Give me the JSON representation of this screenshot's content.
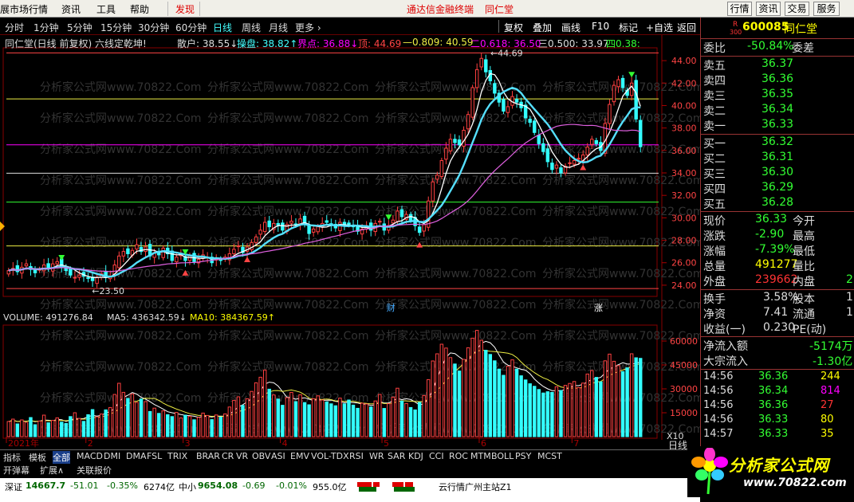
{
  "menu": {
    "items": [
      "展市场行情",
      "资讯",
      "工具",
      "帮助"
    ],
    "discover": "发现",
    "center_title": "通达信金融终端",
    "stock_title": "同仁堂",
    "right_buttons": [
      "行情",
      "资讯",
      "交易",
      "服务"
    ]
  },
  "toolbar": {
    "periods": [
      "分时",
      "1分钟",
      "5分钟",
      "15分钟",
      "30分钟",
      "60分钟",
      "日线",
      "周线",
      "月线",
      "更多 ›"
    ],
    "active_period": "日线",
    "tools": [
      "复权",
      "叠加",
      "画线",
      "F10",
      "标记",
      "+自选",
      "返回"
    ]
  },
  "info": {
    "title": "同仁堂(日线 前复权) 六线定乾坤!",
    "sanhu": "散户: 38.55↓",
    "caopan": "操盘: 38.82↑",
    "jiedian": "界点: 36.88↓",
    "ding": "顶: 44.69",
    "l0809": "—0.809: 40.59",
    "l0618": "二0.618: 36.50",
    "l0500": "三0.500: 33.97",
    "l038": "四0.38:"
  },
  "chart": {
    "price_ticks": [
      "44.00",
      "42.00",
      "40.00",
      "38.00",
      "36.00",
      "34.00",
      "32.00",
      "30.00",
      "28.00",
      "26.00",
      "24.00"
    ],
    "vol_ticks": [
      "60000",
      "45000",
      "30000",
      "15000"
    ],
    "vol_unit": "X10",
    "high_label": "44.69",
    "low_label": "23.50",
    "x_labels": [
      "2021年",
      "2",
      "3",
      "4",
      "5",
      "6",
      "7"
    ],
    "event_cai": "财",
    "event_zhang": "涨",
    "watermark": "分析家公式网www.70822.Com",
    "period_label": "日线",
    "colors": {
      "up": "#ff4040",
      "down": "#33ffff",
      "ma5": "#ffffff",
      "ma10": "#55e0ff",
      "ma_long": "#e060e0",
      "yellow": "#e8e840",
      "green": "#40e040"
    }
  },
  "chart_data": {
    "type": "candlestick",
    "title": "同仁堂(日线 前复权) 六线定乾坤!",
    "ylim": [
      23,
      45
    ],
    "high": 44.69,
    "low": 23.5,
    "levels": [
      {
        "name": "顶",
        "value": 44.69
      },
      {
        "name": "0.809",
        "value": 40.59
      },
      {
        "name": "0.618",
        "value": 36.5
      },
      {
        "name": "0.500",
        "value": 33.97
      },
      {
        "name": "0.38",
        "value": 31.4
      },
      {
        "name": "lower1",
        "value": 27.5
      },
      {
        "name": "lower2",
        "value": 23.7
      }
    ],
    "close": [
      25.3,
      25.5,
      25.2,
      25.6,
      25.9,
      25.4,
      25.1,
      25.4,
      25.8,
      25.5,
      25.9,
      26.1,
      25.7,
      25.3,
      24.9,
      24.7,
      24.9,
      24.8,
      24.6,
      24.4,
      24.7,
      25.0,
      24.7,
      24.8,
      25.8,
      26.6,
      27.0,
      26.8,
      27.1,
      27.6,
      27.0,
      27.4,
      26.6,
      26.9,
      26.7,
      27.3,
      26.8,
      26.2,
      26.5,
      26.8,
      26.2,
      26.6,
      26.1,
      26.3,
      26.7,
      26.5,
      26.0,
      26.4,
      26.2,
      26.5,
      26.8,
      27.2,
      27.5,
      26.9,
      27.4,
      27.8,
      28.3,
      28.9,
      29.6,
      29.2,
      29.5,
      29.3,
      28.9,
      29.4,
      29.7,
      29.4,
      29.9,
      29.5,
      28.6,
      29.0,
      29.2,
      29.5,
      29.6,
      29.3,
      29.1,
      29.6,
      29.3,
      29.4,
      29.2,
      28.8,
      29.0,
      29.3,
      28.9,
      29.5,
      29.7,
      28.9,
      29.3,
      29.8,
      30.6,
      30.1,
      30.3,
      29.8,
      29.3,
      28.7,
      29.4,
      31.5,
      33.2,
      33.8,
      35.1,
      36.2,
      37.0,
      36.7,
      36.5,
      37.8,
      39.2,
      41.6,
      43.2,
      44.2,
      43.0,
      42.2,
      41.1,
      40.3,
      39.5,
      39.9,
      40.8,
      40.3,
      39.8,
      38.9,
      38.5,
      37.6,
      36.6,
      35.9,
      35.0,
      34.3,
      34.7,
      34.0,
      34.6,
      34.9,
      35.1,
      35.3,
      35.6,
      36.3,
      37.0,
      36.6,
      36.0,
      38.4,
      40.1,
      41.8,
      42.3,
      41.6,
      40.9,
      42.0,
      38.8,
      36.33
    ],
    "volume": [
      9500,
      11000,
      8000,
      10500,
      9000,
      12000,
      7500,
      9800,
      13500,
      8700,
      10200,
      11800,
      9100,
      8300,
      12600,
      15000,
      11400,
      9600,
      13800,
      17000,
      12500,
      14200,
      16800,
      18300,
      26500,
      33500,
      27800,
      24000,
      26800,
      21500,
      23600,
      22000,
      15800,
      17900,
      14600,
      16200,
      13800,
      12600,
      15200,
      11800,
      13500,
      12800,
      10600,
      12100,
      14800,
      13300,
      10700,
      13600,
      12200,
      14300,
      18600,
      22800,
      25000,
      19600,
      23800,
      28400,
      33800,
      37300,
      41800,
      29800,
      26200,
      23600,
      19700,
      24500,
      27800,
      22000,
      26300,
      21400,
      20000,
      23800,
      25600,
      23000,
      21800,
      20600,
      19400,
      24200,
      20600,
      23000,
      19800,
      17800,
      21000,
      20500,
      18600,
      22400,
      26500,
      17700,
      20700,
      24800,
      30400,
      22300,
      20800,
      18300,
      16800,
      21500,
      25800,
      35800,
      47500,
      52000,
      58000,
      55600,
      49600,
      45600,
      41200,
      48500,
      55800,
      61800,
      66700,
      60500,
      54200,
      51600,
      47600,
      42400,
      38500,
      44200,
      48200,
      42400,
      38200,
      35600,
      33200,
      31600,
      29600,
      27400,
      28200,
      27800,
      31300,
      29000,
      32200,
      33400,
      34600,
      30800,
      33600,
      39300,
      41500,
      37200,
      34400,
      47600,
      51800,
      47300,
      44600,
      40800,
      43200,
      52000,
      49500,
      49127
    ]
  },
  "vol_info": {
    "volume": "VOLUME: 491276.84",
    "ma5": "MA5: 436342.59↓",
    "ma10": "MA10: 384367.59↑"
  },
  "tabs": [
    "指标",
    "模板",
    "全部",
    "MACD",
    "DMI",
    "DMA",
    "FSL",
    "TRIX",
    "BRAR",
    "CR",
    "VR",
    "OBV",
    "ASI",
    "EMV",
    "VOL-TDX",
    "RSI",
    "WR",
    "SAR",
    "KDJ",
    "CCI",
    "ROC",
    "MTM",
    "BOLL",
    "PSY",
    "MCST"
  ],
  "tabs2": [
    "开弹幕",
    "扩展∧",
    "关联报价"
  ],
  "status": {
    "sz_label": "深证",
    "sz_val": "14667.7",
    "sz_chg": "-51.01",
    "sz_pct": "-0.35%",
    "sz_amt": "6274亿",
    "zx_label": "中小",
    "zx_val": "9654.08",
    "zx_chg": "-0.69",
    "zx_pct": "-0.01%",
    "zx_amt": "955.0亿",
    "server": "云行情广州主站Z1"
  },
  "quote": {
    "code": "600085",
    "name": "同仁堂",
    "r_label": "R",
    "r_num": "300",
    "webi_label": "委比",
    "webi_val": "-50.84%",
    "weicha_label": "委差",
    "sells": [
      {
        "l": "卖五",
        "p": "36.37"
      },
      {
        "l": "卖四",
        "p": "36.36"
      },
      {
        "l": "卖三",
        "p": "36.35"
      },
      {
        "l": "卖二",
        "p": "36.34"
      },
      {
        "l": "卖一",
        "p": "36.33"
      }
    ],
    "buys": [
      {
        "l": "买一",
        "p": "36.32"
      },
      {
        "l": "买二",
        "p": "36.31"
      },
      {
        "l": "买三",
        "p": "36.30"
      },
      {
        "l": "买四",
        "p": "36.29"
      },
      {
        "l": "买五",
        "p": "36.28"
      }
    ],
    "xianjia": {
      "l": "现价",
      "v": "36.33",
      "r": "今开"
    },
    "zhangdie": {
      "l": "涨跌",
      "v": "-2.90",
      "r": "最高"
    },
    "zhangfu": {
      "l": "涨幅",
      "v": "-7.39%",
      "r": "最低"
    },
    "zongliang": {
      "l": "总量",
      "v": "491277",
      "r": "量比"
    },
    "waipan": {
      "l": "外盘",
      "v": "239662",
      "r": "内盘",
      "rv": "2"
    },
    "huanshou": {
      "l": "换手",
      "v": "3.58%",
      "r": "股本",
      "rv": "1"
    },
    "jingzi": {
      "l": "净资",
      "v": "7.41",
      "r": "流通",
      "rv": "1"
    },
    "shouyi": {
      "l": "收益(一)",
      "v": "0.230",
      "r": "PE(动)"
    },
    "jinliuru": {
      "l": "净流入额",
      "v": "-5174万"
    },
    "dazong": {
      "l": "大宗流入",
      "v": "-1.30亿"
    },
    "ticks": [
      {
        "t": "14:56",
        "p": "36.36",
        "v": "244",
        "c": "yel"
      },
      {
        "t": "14:56",
        "p": "36.34",
        "v": "814",
        "c": "mag"
      },
      {
        "t": "14:56",
        "p": "36.36",
        "v": "27",
        "c": "red"
      },
      {
        "t": "14:56",
        "p": "36.33",
        "v": "80",
        "c": "yel"
      },
      {
        "t": "14:57",
        "p": "36.33",
        "v": "35",
        "c": "yel"
      }
    ]
  },
  "logo": {
    "name": "分析家公式网",
    "url": "www.70822.com"
  }
}
